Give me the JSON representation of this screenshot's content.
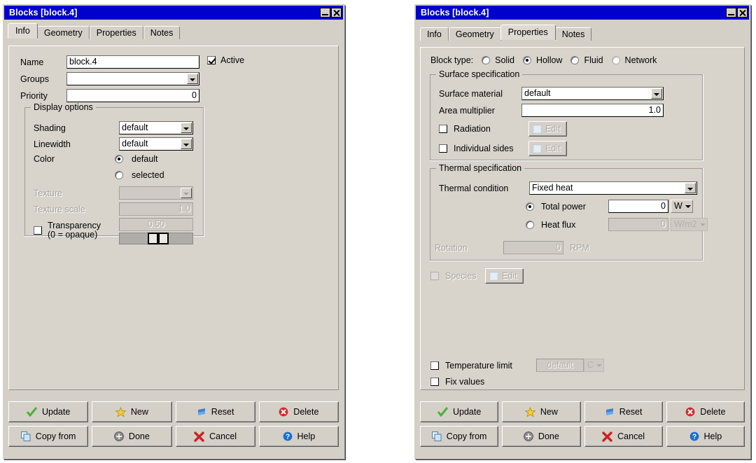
{
  "windows": {
    "left": {
      "title": "Blocks [block.4]",
      "minimize_icon": "minimize-icon",
      "close_icon": "close-icon",
      "tabs": [
        {
          "label": "Info",
          "active": true
        },
        {
          "label": "Geometry",
          "active": false
        },
        {
          "label": "Properties",
          "active": false
        },
        {
          "label": "Notes",
          "active": false
        }
      ],
      "info": {
        "name_label": "Name",
        "name_value": "block.4",
        "groups_label": "Groups",
        "groups_value": "",
        "priority_label": "Priority",
        "priority_value": "0",
        "active_label": "Active",
        "active_checked": true
      },
      "display_options": {
        "title": "Display options",
        "shading_label": "Shading",
        "shading_value": "default",
        "linewidth_label": "Linewidth",
        "linewidth_value": "default",
        "color_label": "Color",
        "color_default_label": "default",
        "color_selected_label": "selected",
        "color_choice": "default",
        "texture_label": "Texture",
        "texture_value": "",
        "texture_scale_label": "Texture scale",
        "texture_scale_value": "1.0",
        "transparency_label_line1": "Transparency",
        "transparency_label_line2": "(0 = opaque)",
        "transparency_value": "0.50",
        "transparency_checked": false
      }
    },
    "right": {
      "title": "Blocks [block.4]",
      "minimize_icon": "minimize-icon",
      "close_icon": "close-icon",
      "tabs": [
        {
          "label": "Info",
          "active": false
        },
        {
          "label": "Geometry",
          "active": false
        },
        {
          "label": "Properties",
          "active": true
        },
        {
          "label": "Notes",
          "active": false
        }
      ],
      "properties": {
        "block_type_label": "Block type:",
        "block_type_options": [
          "Solid",
          "Hollow",
          "Fluid",
          "Network"
        ],
        "block_type_selected": "Hollow",
        "surface_spec": {
          "title": "Surface specification",
          "surface_material_label": "Surface material",
          "surface_material_value": "default",
          "area_multiplier_label": "Area multiplier",
          "area_multiplier_value": "1.0",
          "radiation_label": "Radiation",
          "radiation_checked": false,
          "radiation_edit_label": "Edit",
          "individual_sides_label": "Individual sides",
          "individual_sides_checked": false,
          "individual_sides_edit_label": "Edit"
        },
        "thermal_spec": {
          "title": "Thermal specification",
          "thermal_condition_label": "Thermal condition",
          "thermal_condition_value": "Fixed heat",
          "total_power_label": "Total power",
          "total_power_value": "0",
          "total_power_unit": "W",
          "heat_flux_label": "Heat flux",
          "heat_flux_value": "0",
          "heat_flux_unit": "W/m2",
          "power_mode_selected": "Total power",
          "rotation_label": "Rotation",
          "rotation_value": "0",
          "rotation_unit": "RPM"
        },
        "species_label": "Species",
        "species_checked": false,
        "species_edit_label": "Edit",
        "temperature_limit_label": "Temperature limit",
        "temperature_limit_checked": false,
        "temperature_limit_value": "default",
        "temperature_limit_unit": "C",
        "fix_values_label": "Fix values",
        "fix_values_checked": false
      }
    }
  },
  "buttons": {
    "update": "Update",
    "new": "New",
    "reset": "Reset",
    "delete": "Delete",
    "copy_from": "Copy from",
    "done": "Done",
    "cancel": "Cancel",
    "help": "Help"
  },
  "colors": {
    "titlebar": "#0000cc",
    "window_face": "#d4d0c8",
    "panel_face": "#d8d4cc",
    "field": "#ffffff",
    "disabled_text": "#b0aca7",
    "check_green": "#4caf36",
    "star_yellow": "#ffcc33",
    "reset_blue": "#3d7fd0",
    "delete_red": "#d42a2a",
    "cancel_red": "#cc2222",
    "help_blue": "#1a6fd4"
  }
}
